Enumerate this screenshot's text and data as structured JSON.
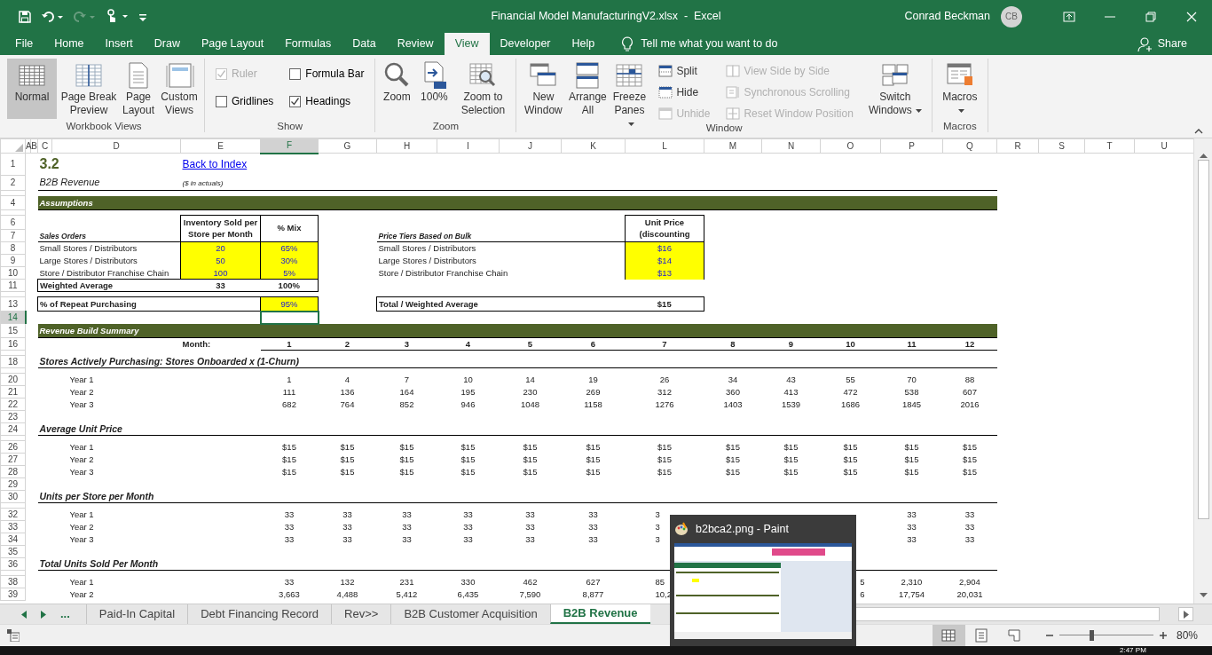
{
  "title_bar": {
    "title": "Financial Model ManufacturingV2.xlsx  -  Excel",
    "user": "Conrad Beckman",
    "avatar_initials": "CB"
  },
  "ribbon_tabs": [
    {
      "label": "File",
      "selected": false
    },
    {
      "label": "Home",
      "selected": false
    },
    {
      "label": "Insert",
      "selected": false
    },
    {
      "label": "Draw",
      "selected": false
    },
    {
      "label": "Page Layout",
      "selected": false
    },
    {
      "label": "Formulas",
      "selected": false
    },
    {
      "label": "Data",
      "selected": false
    },
    {
      "label": "Review",
      "selected": false
    },
    {
      "label": "View",
      "selected": true
    },
    {
      "label": "Developer",
      "selected": false
    },
    {
      "label": "Help",
      "selected": false
    }
  ],
  "tell_me": "Tell me what you want to do",
  "share": "Share",
  "ribbon_groups": [
    {
      "label": "Workbook Views",
      "items": [
        {
          "kind": "large",
          "label": "Normal",
          "selected": true
        },
        {
          "kind": "large",
          "label": "Page Break Preview",
          "selected": false
        },
        {
          "kind": "large",
          "label": "Page Layout",
          "selected": false
        },
        {
          "kind": "large",
          "label": "Custom Views",
          "selected": false
        }
      ]
    },
    {
      "label": "Show",
      "items": [
        {
          "kind": "checkbox",
          "label": "Ruler",
          "checked": true,
          "disabled": true
        },
        {
          "kind": "checkbox",
          "label": "Gridlines",
          "checked": false,
          "disabled": false
        },
        {
          "kind": "checkbox",
          "label": "Formula Bar",
          "checked": false,
          "disabled": false
        },
        {
          "kind": "checkbox",
          "label": "Headings",
          "checked": true,
          "disabled": false
        }
      ]
    },
    {
      "label": "Zoom",
      "items": [
        {
          "kind": "large",
          "label": "Zoom"
        },
        {
          "kind": "large",
          "label": "100%"
        },
        {
          "kind": "large",
          "label": "Zoom to Selection"
        }
      ]
    },
    {
      "label": "Window",
      "items": [
        {
          "kind": "large",
          "label": "New Window"
        },
        {
          "kind": "large",
          "label": "Arrange All"
        },
        {
          "kind": "large",
          "label": "Freeze Panes",
          "dropdown": true
        },
        {
          "kind": "small",
          "label": "Split",
          "disabled": false
        },
        {
          "kind": "small",
          "label": "Hide",
          "disabled": false
        },
        {
          "kind": "small",
          "label": "Unhide",
          "disabled": true
        },
        {
          "kind": "small",
          "label": "View Side by Side",
          "disabled": true
        },
        {
          "kind": "small",
          "label": "Synchronous Scrolling",
          "disabled": true
        },
        {
          "kind": "small",
          "label": "Reset Window Position",
          "disabled": true
        },
        {
          "kind": "large",
          "label": "Switch Windows",
          "dropdown": true
        }
      ]
    },
    {
      "label": "Macros",
      "items": [
        {
          "kind": "large",
          "label": "Macros",
          "dropdown": true
        }
      ]
    }
  ],
  "sheet": {
    "columns": [
      {
        "label": "A",
        "selected": false
      },
      {
        "label": "B",
        "selected": false
      },
      {
        "label": "C",
        "selected": false
      },
      {
        "label": "D",
        "selected": false
      },
      {
        "label": "E",
        "selected": false
      },
      {
        "label": "F",
        "selected": true
      },
      {
        "label": "G",
        "selected": false
      },
      {
        "label": "H",
        "selected": false
      },
      {
        "label": "I",
        "selected": false
      },
      {
        "label": "J",
        "selected": false
      },
      {
        "label": "K",
        "selected": false
      },
      {
        "label": "L",
        "selected": false
      },
      {
        "label": "M",
        "selected": false
      },
      {
        "label": "N",
        "selected": false
      },
      {
        "label": "O",
        "selected": false
      },
      {
        "label": "P",
        "selected": false
      },
      {
        "label": "Q",
        "selected": false
      },
      {
        "label": "R",
        "selected": false
      },
      {
        "label": "S",
        "selected": false
      },
      {
        "label": "T",
        "selected": false
      },
      {
        "label": "U",
        "selected": false
      }
    ],
    "rows": [
      {
        "number": "1",
        "kind": "title",
        "selected": false,
        "cells": {
          "c": {
            "text": "3.2",
            "kind": "title"
          },
          "e": {
            "text": "Back to Index",
            "kind": "link"
          }
        }
      },
      {
        "number": "2",
        "kind": "subtitle",
        "selected": false,
        "cells": {
          "c": {
            "text": "B2B Revenue",
            "kind": "subtitle"
          },
          "e": {
            "text": "($ in actuals)",
            "kind": "note"
          }
        }
      },
      {
        "kind": "spacer",
        "selected": false
      },
      {
        "number": "4",
        "kind": "band",
        "selected": false,
        "label": "Assumptions"
      },
      {
        "kind": "spacer",
        "selected": false
      },
      {
        "number": "6",
        "kind": "table-top",
        "selected": false,
        "cells": {
          "e": {
            "text": "Inventory Sold per Store per Month",
            "kind": "header"
          },
          "f": {
            "text": "% Mix",
            "kind": "header"
          },
          "l": {
            "text": "Unit Price (discounting",
            "kind": "header"
          }
        }
      },
      {
        "number": "7",
        "kind": "table-head",
        "selected": false,
        "cells": {
          "c": {
            "text": "Sales Orders",
            "kind": "caption"
          },
          "h": {
            "text": "Price Tiers Based on Bulk",
            "kind": "caption"
          }
        }
      },
      {
        "number": "8",
        "kind": "table-row",
        "selected": false,
        "cells": {
          "c": "Small Stores / Distributors",
          "e": {
            "text": "20",
            "kind": "input"
          },
          "f": {
            "text": "65%",
            "kind": "input"
          },
          "h": "Small Stores / Distributors",
          "l": {
            "text": "$16",
            "kind": "input"
          }
        }
      },
      {
        "number": "9",
        "kind": "table-row",
        "selected": false,
        "cells": {
          "c": "Large Stores / Distributors",
          "e": {
            "text": "50",
            "kind": "input"
          },
          "f": {
            "text": "30%",
            "kind": "input"
          },
          "h": "Large Stores / Distributors",
          "l": {
            "text": "$14",
            "kind": "input"
          }
        }
      },
      {
        "number": "10",
        "kind": "table-row",
        "selected": false,
        "cells": {
          "c": "Store / Distributor Franchise Chain",
          "e": {
            "text": "100",
            "kind": "input"
          },
          "f": {
            "text": "5%",
            "kind": "input"
          },
          "h": "Store / Distributor Franchise Chain",
          "l": {
            "text": "$13",
            "kind": "input"
          }
        }
      },
      {
        "number": "11",
        "kind": "table-total",
        "selected": false,
        "cells": {
          "c": {
            "text": "Weighted Average",
            "kind": "bold"
          },
          "e": {
            "text": "33",
            "kind": "total"
          },
          "f": {
            "text": "100%",
            "kind": "total"
          }
        }
      },
      {
        "kind": "spacer",
        "selected": false
      },
      {
        "number": "13",
        "kind": "table-summary",
        "selected": false,
        "cells": {
          "c": {
            "text": "% of Repeat Purchasing",
            "kind": "bold"
          },
          "f": {
            "text": "95%",
            "kind": "input"
          },
          "h": {
            "text": "Total / Weighted Average",
            "kind": "bold"
          },
          "l": {
            "text": "$15",
            "kind": "total"
          }
        }
      },
      {
        "number": "14",
        "kind": "normal",
        "selected": true
      },
      {
        "number": "15",
        "kind": "band",
        "selected": false,
        "label": "Revenue Build Summary"
      },
      {
        "number": "16",
        "kind": "months",
        "selected": false,
        "label": "Month:",
        "cells": {
          "f": "1",
          "g": "2",
          "h": "3",
          "i": "4",
          "j": "5",
          "k": "6",
          "l": "7",
          "m": "8",
          "n": "9",
          "o": "10",
          "p": "11",
          "q": "12"
        }
      },
      {
        "kind": "spacer",
        "selected": false
      },
      {
        "number": "18",
        "kind": "section",
        "selected": false,
        "label": "Stores Actively Purchasing: Stores Onboarded x (1-Churn)"
      },
      {
        "kind": "spacer",
        "selected": false
      },
      {
        "number": "20",
        "kind": "data",
        "selected": false,
        "label": "Year 1",
        "cells": {
          "f": "1",
          "g": "4",
          "h": "7",
          "i": "10",
          "j": "14",
          "k": "19",
          "l": "26",
          "m": "34",
          "n": "43",
          "o": "55",
          "p": "70",
          "q": "88"
        }
      },
      {
        "number": "21",
        "kind": "data",
        "selected": false,
        "label": "Year 2",
        "cells": {
          "f": "111",
          "g": "136",
          "h": "164",
          "i": "195",
          "j": "230",
          "k": "269",
          "l": "312",
          "m": "360",
          "n": "413",
          "o": "472",
          "p": "538",
          "q": "607"
        }
      },
      {
        "number": "22",
        "kind": "data",
        "selected": false,
        "label": "Year 3",
        "cells": {
          "f": "682",
          "g": "764",
          "h": "852",
          "i": "946",
          "j": "1048",
          "k": "1158",
          "l": "1276",
          "m": "1403",
          "n": "1539",
          "o": "1686",
          "p": "1845",
          "q": "2016"
        }
      },
      {
        "number": "23",
        "kind": "normal",
        "selected": false
      },
      {
        "number": "24",
        "kind": "section",
        "selected": false,
        "label": "Average Unit Price"
      },
      {
        "kind": "spacer",
        "selected": false
      },
      {
        "number": "26",
        "kind": "data",
        "selected": false,
        "label": "Year 1",
        "cells": {
          "f": "$15",
          "g": "$15",
          "h": "$15",
          "i": "$15",
          "j": "$15",
          "k": "$15",
          "l": "$15",
          "m": "$15",
          "n": "$15",
          "o": "$15",
          "p": "$15",
          "q": "$15"
        }
      },
      {
        "number": "27",
        "kind": "data",
        "selected": false,
        "label": "Year 2",
        "cells": {
          "f": "$15",
          "g": "$15",
          "h": "$15",
          "i": "$15",
          "j": "$15",
          "k": "$15",
          "l": "$15",
          "m": "$15",
          "n": "$15",
          "o": "$15",
          "p": "$15",
          "q": "$15"
        }
      },
      {
        "number": "28",
        "kind": "data",
        "selected": false,
        "label": "Year 3",
        "cells": {
          "f": "$15",
          "g": "$15",
          "h": "$15",
          "i": "$15",
          "j": "$15",
          "k": "$15",
          "l": "$15",
          "m": "$15",
          "n": "$15",
          "o": "$15",
          "p": "$15",
          "q": "$15"
        }
      },
      {
        "number": "29",
        "kind": "normal",
        "selected": false
      },
      {
        "number": "30",
        "kind": "section",
        "selected": false,
        "label": "Units per Store per Month"
      },
      {
        "kind": "spacer",
        "selected": false
      },
      {
        "number": "32",
        "kind": "data",
        "selected": false,
        "label": "Year 1",
        "cells": {
          "f": "33",
          "g": "33",
          "h": "33",
          "i": "33",
          "j": "33",
          "k": "33",
          "l": {
            "text": "3",
            "kind": "cut-right"
          },
          "p": "33",
          "q": "33"
        }
      },
      {
        "number": "33",
        "kind": "data",
        "selected": false,
        "label": "Year 2",
        "cells": {
          "f": "33",
          "g": "33",
          "h": "33",
          "i": "33",
          "j": "33",
          "k": "33",
          "l": {
            "text": "3",
            "kind": "cut-right"
          },
          "p": "33",
          "q": "33"
        }
      },
      {
        "number": "34",
        "kind": "data",
        "selected": false,
        "label": "Year 3",
        "cells": {
          "f": "33",
          "g": "33",
          "h": "33",
          "i": "33",
          "j": "33",
          "k": "33",
          "l": {
            "text": "3",
            "kind": "cut-right"
          },
          "p": "33",
          "q": "33"
        }
      },
      {
        "number": "35",
        "kind": "normal",
        "selected": false
      },
      {
        "number": "36",
        "kind": "section",
        "selected": false,
        "label": "Total Units Sold Per Month"
      },
      {
        "kind": "spacer",
        "selected": false
      },
      {
        "number": "38",
        "kind": "data",
        "selected": false,
        "label": "Year 1",
        "cells": {
          "f": "33",
          "g": "132",
          "h": "231",
          "i": "330",
          "j": "462",
          "k": "627",
          "l": {
            "text": "85",
            "kind": "cut-right"
          },
          "o": {
            "text": "5",
            "kind": "cut-left"
          },
          "p": "2,310",
          "q": "2,904"
        }
      },
      {
        "number": "39",
        "kind": "data",
        "selected": false,
        "label": "Year 2",
        "cells": {
          "f": "3,663",
          "g": "4,488",
          "h": "5,412",
          "i": "6,435",
          "j": "7,590",
          "k": "8,877",
          "l": {
            "text": "10,2",
            "kind": "cut-right"
          },
          "o": {
            "text": "6",
            "kind": "cut-left"
          },
          "p": "17,754",
          "q": "20,031"
        }
      }
    ]
  },
  "sheet_tabs": {
    "more": "...",
    "tabs": [
      {
        "label": "Paid-In Capital",
        "selected": false
      },
      {
        "label": "Debt Financing Record",
        "selected": false
      },
      {
        "label": "Rev>>",
        "selected": false
      },
      {
        "label": "B2B Customer Acquisition",
        "selected": false
      },
      {
        "label": "B2B Revenue",
        "selected": true
      }
    ]
  },
  "status_bar": {
    "views": [
      {
        "selected": true
      },
      {
        "selected": false
      },
      {
        "selected": false
      }
    ],
    "zoom": {
      "level": 0.34,
      "reading": "80%"
    }
  },
  "thumbnail_preview": {
    "title": "b2bca2.png - Paint"
  },
  "taskbar": {
    "clock": "2:47 PM"
  }
}
